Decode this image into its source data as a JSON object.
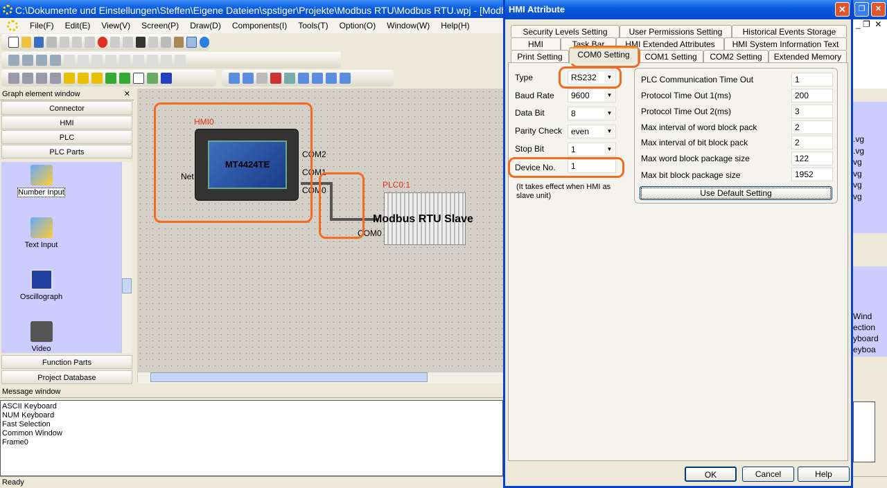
{
  "window": {
    "title": "C:\\Dokumente und Einstellungen\\Steffen\\Eigene Dateien\\spstiger\\Projekte\\Modbus RTU\\Modbus RTU.wpj - [Modbu"
  },
  "menu": [
    "File(F)",
    "Edit(E)",
    "View(V)",
    "Screen(P)",
    "Draw(D)",
    "Components(I)",
    "Tools(T)",
    "Option(O)",
    "Window(W)",
    "Help(H)"
  ],
  "graph_window": {
    "title": "Graph element window",
    "categories": [
      "Connector",
      "HMI",
      "PLC",
      "PLC Parts"
    ],
    "parts": [
      "Number Input",
      "Text Input",
      "Oscillograph",
      "Video"
    ],
    "bottom_categories": [
      "Function Parts",
      "Project Database"
    ]
  },
  "canvas": {
    "hmi_label": "HMI0",
    "hmi_model": "MT4424TE",
    "net_label": "Net",
    "ports": [
      "COM2",
      "COM1",
      "COM0"
    ],
    "plc_label": "PLC0:1",
    "plc_name": "Modbus RTU Slave",
    "plc_port": "COM0",
    "highlight_color": "#f26b21"
  },
  "message_window": {
    "title": "Message window",
    "lines": [
      "ASCII Keyboard",
      "NUM Keyboard",
      "Fast Selection",
      "Common Window",
      "Frame0"
    ]
  },
  "status": "Ready",
  "right_panel": {
    "files": [
      ".vg",
      ".vg",
      "vg",
      "vg",
      "vg",
      "vg"
    ],
    "list": [
      "Wind",
      "ection",
      "yboard",
      "eyboa"
    ]
  },
  "dialog": {
    "title": "HMI Attribute",
    "tabs_row1": [
      "Security Levels Setting",
      "User Permissions Setting",
      "Historical Events Storage"
    ],
    "tabs_row2": [
      "HMI",
      "Task Bar",
      "HMI Extended Attributes",
      "HMI System Information Text"
    ],
    "tabs_row3": [
      "Print Setting",
      "COM0 Setting",
      "COM1 Setting",
      "COM2 Setting",
      "Extended Memory"
    ],
    "active_tab": "COM0 Setting",
    "left_fields": [
      {
        "label": "Type",
        "value": "RS232",
        "dropdown": true
      },
      {
        "label": "Baud Rate",
        "value": "9600",
        "dropdown": true
      },
      {
        "label": "Data Bit",
        "value": "8",
        "dropdown": true
      },
      {
        "label": "Parity Check",
        "value": "even",
        "dropdown": true
      },
      {
        "label": "Stop Bit",
        "value": "1",
        "dropdown": true
      },
      {
        "label": "Device No.",
        "value": "1",
        "dropdown": false
      }
    ],
    "note": "(It takes effect when HMI as slave unit)",
    "right_fields": [
      {
        "label": "PLC Communication Time Out",
        "value": "1"
      },
      {
        "label": "Protocol Time Out 1(ms)",
        "value": "200"
      },
      {
        "label": "Protocol Time Out 2(ms)",
        "value": "3"
      },
      {
        "label": "Max interval of word block pack",
        "value": "2"
      },
      {
        "label": "Max interval of bit block pack",
        "value": "2"
      },
      {
        "label": "Max word block package size",
        "value": "122"
      },
      {
        "label": "Max bit block package size",
        "value": "1952"
      }
    ],
    "default_button": "Use Default Setting",
    "ok": "OK",
    "cancel": "Cancel",
    "help": "Help"
  }
}
